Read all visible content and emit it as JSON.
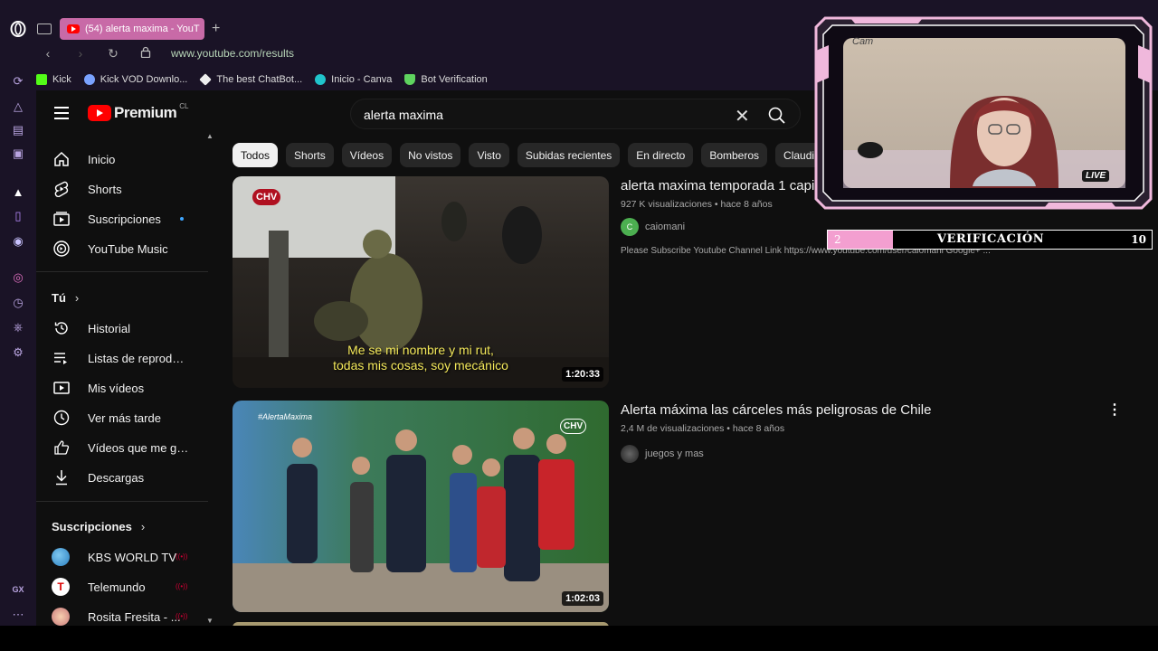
{
  "browser": {
    "tab_title": "(54) alerta maxima - YouT",
    "url": "www.youtube.com/results",
    "bookmarks": [
      "Kick",
      "Kick VOD Downlo...",
      "The best ChatBot...",
      "Inicio - Canva",
      "Bot Verification"
    ]
  },
  "youtube": {
    "logo_text": "Premium",
    "country_code": "CL",
    "search_query": "alerta maxima"
  },
  "sidebar": {
    "main": [
      "Inicio",
      "Shorts",
      "Suscripciones",
      "YouTube Music"
    ],
    "you_header": "Tú",
    "you": [
      "Historial",
      "Listas de reproducc...",
      "Mis vídeos",
      "Ver más tarde",
      "Vídeos que me gus...",
      "Descargas"
    ],
    "subs_header": "Suscripciones",
    "subs": [
      "KBS WORLD TV",
      "Telemundo",
      "Rosita Fresita - ..."
    ]
  },
  "chips": [
    "Todos",
    "Shorts",
    "Vídeos",
    "No vistos",
    "Visto",
    "Subidas recientes",
    "En directo",
    "Bomberos",
    "Claudio"
  ],
  "results": [
    {
      "title": "alerta maxima temporada 1 capi",
      "meta": "927 K visualizaciones • hace 8 años",
      "channel": "caiomani",
      "channel_initial": "C",
      "description": "Please Subscribe Youtube Channel Link https://www.youtube.com/user/caiomani Google+ ...",
      "duration": "1:20:33",
      "subtitle_line1": "Me se mi nombre y mi rut,",
      "subtitle_line2": "todas mis cosas, soy mecánico",
      "thumb_logo": "CHV"
    },
    {
      "title": "Alerta máxima las cárceles más peligrosas de Chile",
      "meta": "2,4 M de visualizaciones • hace 8 años",
      "channel": "juegos y mas",
      "duration": "1:02:03",
      "hashtag": "#AlertaMaxima",
      "thumb_logo": "CHV"
    }
  ],
  "overlay": {
    "cam_label": "Cam",
    "live_badge": "LIVE",
    "verification_label": "VERIFICACIÓN",
    "verification_current": "2",
    "verification_goal": "10",
    "verification_progress": 0.2
  },
  "colors": {
    "accent_pink": "#f39fd0",
    "yt_red": "#ff0000",
    "browser_bg": "#1a1326",
    "yt_bg": "#0f0f0f"
  }
}
